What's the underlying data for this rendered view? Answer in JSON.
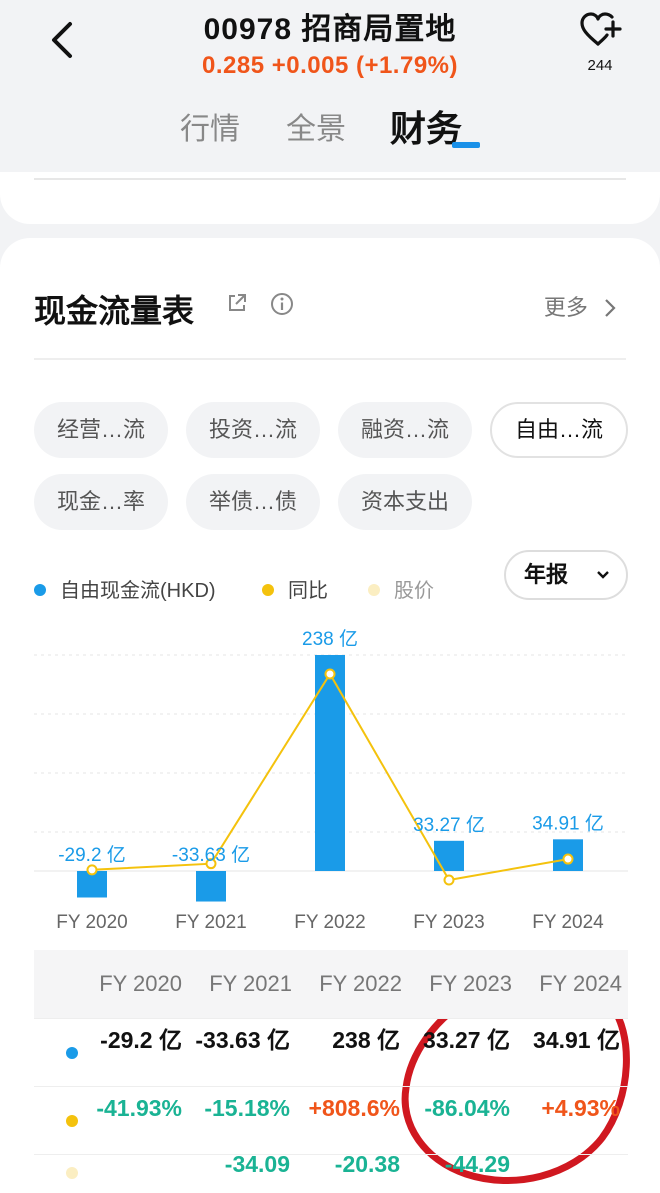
{
  "header": {
    "title": "00978 招商局置地",
    "quote": "0.285  +0.005  (+1.79%)",
    "fav_count": "244",
    "tabs": [
      {
        "label": "行情"
      },
      {
        "label": "全景"
      },
      {
        "label": "财务"
      }
    ]
  },
  "section": {
    "title": "现金流量表",
    "more": "更多"
  },
  "chips": [
    {
      "label": "经营…流"
    },
    {
      "label": "投资…流"
    },
    {
      "label": "融资…流"
    },
    {
      "label": "自由…流"
    },
    {
      "label": "现金…率"
    },
    {
      "label": "举债…债"
    },
    {
      "label": "资本支出"
    }
  ],
  "legend": [
    {
      "label": "自由现金流(HKD)",
      "color": "#1a9be8"
    },
    {
      "label": "同比",
      "color": "#f4c20d"
    },
    {
      "label": "股价",
      "color": "#fbeec2"
    }
  ],
  "period_select": "年报",
  "chart_data": {
    "type": "bar",
    "categories": [
      "FY 2020",
      "FY 2021",
      "FY 2022",
      "FY 2023",
      "FY 2024"
    ],
    "series": [
      {
        "name": "自由现金流(HKD)",
        "values": [
          -29.2,
          -33.63,
          238,
          33.27,
          34.91
        ],
        "labels": [
          "-29.2 亿",
          "-33.63 亿",
          "238 亿",
          "33.27 亿",
          "34.91 亿"
        ],
        "color": "#1a9be8"
      },
      {
        "name": "同比",
        "values": [
          -41.93,
          -15.18,
          808.6,
          -86.04,
          4.93
        ],
        "color": "#f4c20d",
        "type": "line"
      }
    ]
  },
  "table": {
    "headers": [
      "FY 2020",
      "FY 2021",
      "FY 2022",
      "FY 2023",
      "FY 2024"
    ],
    "rows": [
      {
        "dot": "#1a9be8",
        "cells": [
          {
            "text": "-29.2 亿",
            "color": "#111111"
          },
          {
            "text": "-33.63 亿",
            "color": "#111111"
          },
          {
            "text": "238 亿",
            "color": "#111111"
          },
          {
            "text": "33.27 亿",
            "color": "#111111"
          },
          {
            "text": "34.91 亿",
            "color": "#111111"
          }
        ]
      },
      {
        "dot": "#f4c20d",
        "cells": [
          {
            "text": "-41.93%",
            "color": "#1ab394"
          },
          {
            "text": "-15.18%",
            "color": "#1ab394"
          },
          {
            "text": "+808.6%",
            "color": "#f0551a"
          },
          {
            "text": "-86.04%",
            "color": "#1ab394"
          },
          {
            "text": "+4.93%",
            "color": "#f0551a"
          }
        ]
      },
      {
        "dot": "#fbeec2",
        "cells": [
          {
            "text": "",
            "color": "#1ab394"
          },
          {
            "text": "-34.09",
            "color": "#1ab394"
          },
          {
            "text": "-20.38",
            "color": "#1ab394"
          },
          {
            "text": "-44.29",
            "color": "#1ab394"
          },
          {
            "text": "",
            "color": "#f0551a"
          }
        ]
      }
    ]
  }
}
